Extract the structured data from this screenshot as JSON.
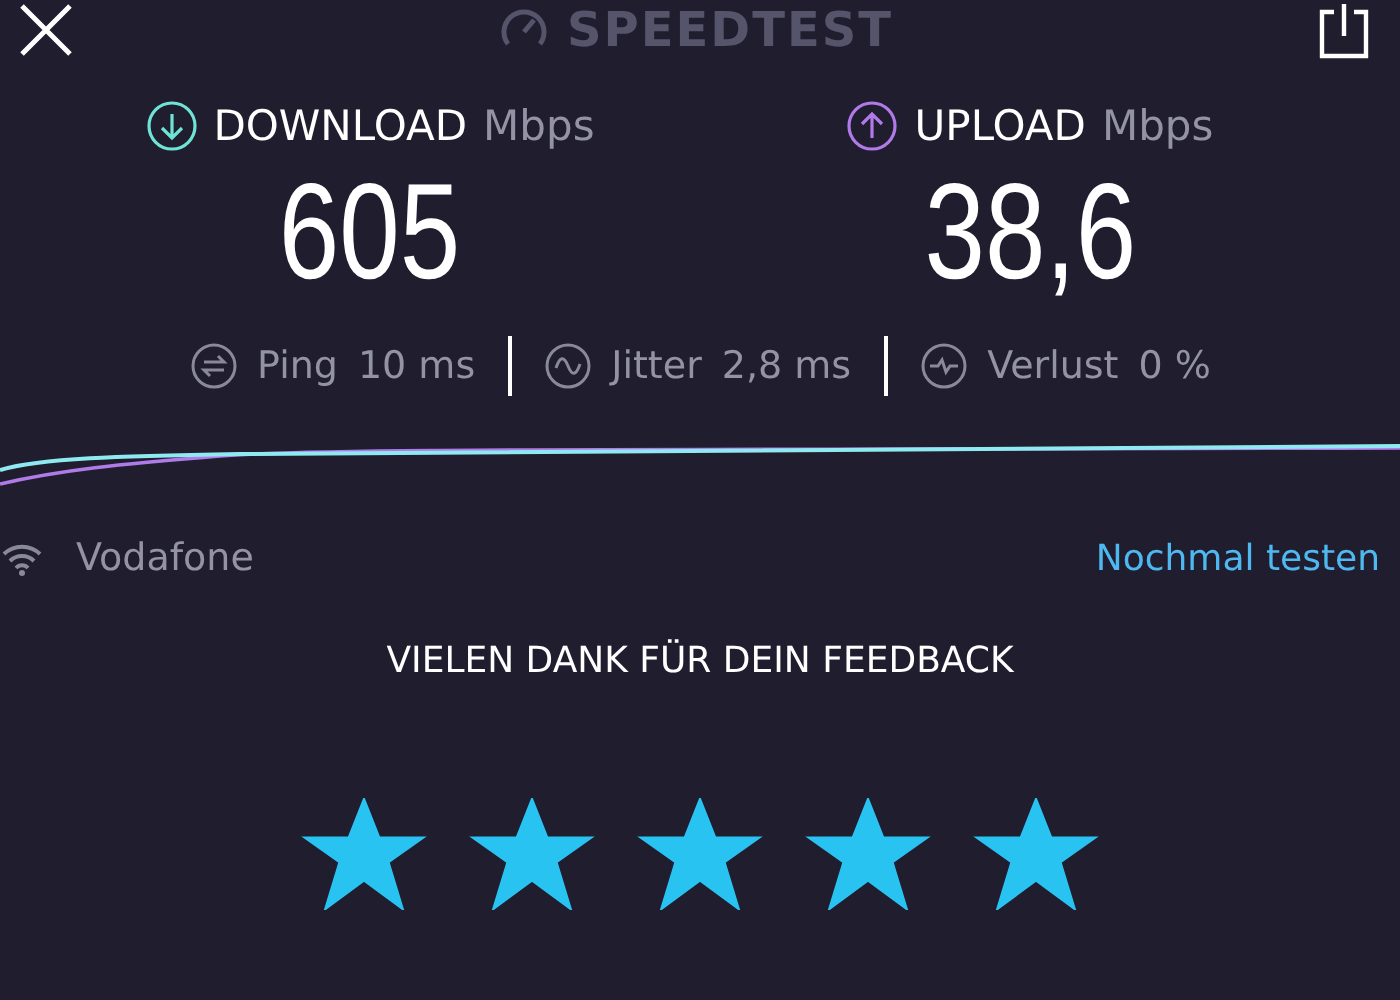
{
  "header": {
    "title": "SPEEDTEST"
  },
  "results": [
    {
      "kind": "download",
      "label": "DOWNLOAD",
      "unit": "Mbps",
      "value": "605"
    },
    {
      "kind": "upload",
      "label": "UPLOAD",
      "unit": "Mbps",
      "value": "38,6"
    }
  ],
  "metrics": [
    {
      "kind": "ping",
      "label": "Ping",
      "value": "10 ms"
    },
    {
      "kind": "jitter",
      "label": "Jitter",
      "value": "2,8 ms"
    },
    {
      "kind": "loss",
      "label": "Verlust",
      "value": "0 %"
    }
  ],
  "provider": "Vodafone",
  "retest": "Nochmal testen",
  "feedback": {
    "title": "VIELEN DANK FÜR DEIN FEEDBACK",
    "stars": 5
  }
}
